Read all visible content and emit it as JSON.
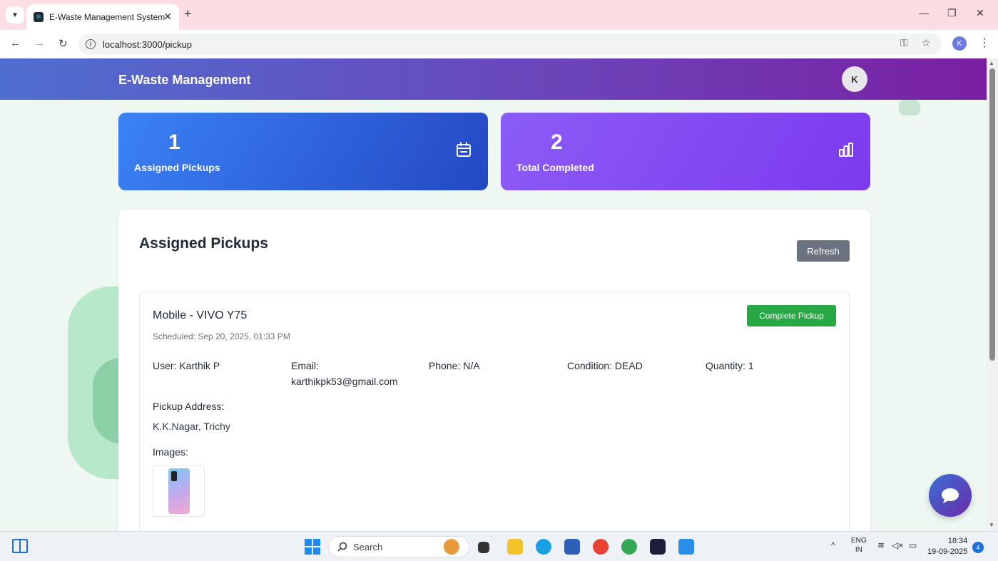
{
  "browser": {
    "tab_title": "E-Waste Management System",
    "tab_close": "✕",
    "new_tab": "+",
    "url": "localhost:3000/pickup",
    "profile_initial": "K"
  },
  "header": {
    "brand": "E-Waste Management",
    "avatar_initial": "K"
  },
  "stats": [
    {
      "value": "1",
      "label": "Assigned Pickups",
      "icon": "calendar-icon"
    },
    {
      "value": "2",
      "label": "Total Completed",
      "icon": "bar-chart-icon"
    }
  ],
  "panel": {
    "title": "Assigned Pickups",
    "refresh_label": "Refresh"
  },
  "pickup": {
    "title": "Mobile - VIVO Y75",
    "scheduled": "Scheduled: Sep 20, 2025, 01:33 PM",
    "complete_label": "Complete Pickup",
    "user": "User: Karthik P",
    "email_label": "Email:",
    "email": "karthikpk53@gmail.com",
    "phone": "Phone: N/A",
    "condition": "Condition: DEAD",
    "quantity": "Quantity: 1",
    "address_label": "Pickup Address:",
    "address": "K.K.Nagar, Trichy",
    "images_label": "Images:"
  },
  "taskbar": {
    "search_label": "Search",
    "lang_top": "ENG",
    "lang_bottom": "IN",
    "time": "18:34",
    "date": "19-09-2025",
    "notification_count": "4"
  },
  "colors": {
    "header_start": "#4f6fd0",
    "header_end": "#7a1fa2",
    "stat_blue": "#2448c3",
    "stat_purple": "#7c3aed",
    "complete_green": "#28a745",
    "refresh_gray": "#6b7280"
  }
}
